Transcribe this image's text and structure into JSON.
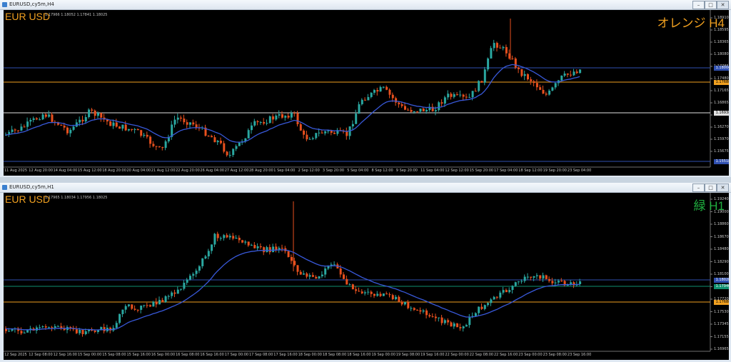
{
  "windows": [
    {
      "title": "EURUSD,cy5m,H4",
      "symbol": "EUR USD",
      "ohlc": "1.17966 1.18052 1.17841 1.18025",
      "tag": "オレンジ H4",
      "tag_color": "#f0a020",
      "prices": [
        "1.18910",
        "1.18595",
        "1.18365",
        "1.18080",
        "1.17785",
        "1.17480",
        "1.17165",
        "1.16865",
        "1.16570",
        "1.16270",
        "1.15970",
        "1.15675"
      ],
      "price_boxes": [
        {
          "text": "1.18004",
          "bg": "#3050b0",
          "fg": "#ffffff"
        },
        {
          "text": "1.17688",
          "bg": "#f0a020",
          "fg": "#000000"
        },
        {
          "text": "1.16938",
          "bg": "#e0e0e0",
          "fg": "#000000"
        },
        {
          "text": "1.15518",
          "bg": "#3050b0",
          "fg": "#ffffff"
        }
      ],
      "times": [
        "11 Aug 2025",
        "12 Aug 20:00",
        "14 Aug 04:00",
        "15 Aug 12:00",
        "18 Aug 20:00",
        "20 Aug 04:00",
        "21 Aug 12:00",
        "22 Aug 20:00",
        "26 Aug 04:00",
        "27 Aug 12:00",
        "28 Aug 20:00",
        "1 Sep 04:00",
        "2 Sep 12:00",
        "3 Sep 20:00",
        "5 Sep 04:00",
        "8 Sep 12:00",
        "9 Sep 20:00",
        "11 Sep 04:00",
        "12 Sep 12:00",
        "15 Sep 20:00",
        "17 Sep 04:00",
        "18 Sep 12:00",
        "19 Sep 20:00",
        "23 Sep 04:00"
      ]
    },
    {
      "title": "EURUSD,cy5m,H1",
      "symbol": "EUR USD",
      "ohlc": "1.17965 1.18034 1.17956 1.18025",
      "tag": "緑 H1",
      "tag_color": "#20b040",
      "prices": [
        "1.19240",
        "1.19000",
        "1.18860",
        "1.18670",
        "1.18480",
        "1.18290",
        "1.18100",
        "1.17910",
        "1.17720",
        "1.17530",
        "1.17345",
        "1.17155",
        "1.16965"
      ],
      "price_boxes": [
        {
          "text": "1.18028",
          "bg": "#3050b0",
          "fg": "#ffffff"
        },
        {
          "text": "1.17940",
          "bg": "#109070",
          "fg": "#ffffff"
        },
        {
          "text": "1.17688",
          "bg": "#f0a020",
          "fg": "#000000"
        }
      ],
      "times": [
        "12 Sep 2025",
        "12 Sep 08:00",
        "12 Sep 16:00",
        "15 Sep 00:00",
        "15 Sep 08:00",
        "15 Sep 16:00",
        "16 Sep 00:00",
        "16 Sep 08:00",
        "16 Sep 16:00",
        "17 Sep 00:00",
        "17 Sep 08:00",
        "17 Sep 16:00",
        "18 Sep 00:00",
        "18 Sep 08:00",
        "18 Sep 16:00",
        "19 Sep 00:00",
        "19 Sep 08:00",
        "19 Sep 16:00",
        "22 Sep 00:00",
        "22 Sep 08:00",
        "22 Sep 16:00",
        "23 Sep 00:00",
        "23 Sep 08:00",
        "23 Sep 16:00"
      ]
    }
  ],
  "colors": {
    "bull": "#2aa7a0",
    "bear": "#e8501e",
    "ma": "#3858d8"
  }
}
